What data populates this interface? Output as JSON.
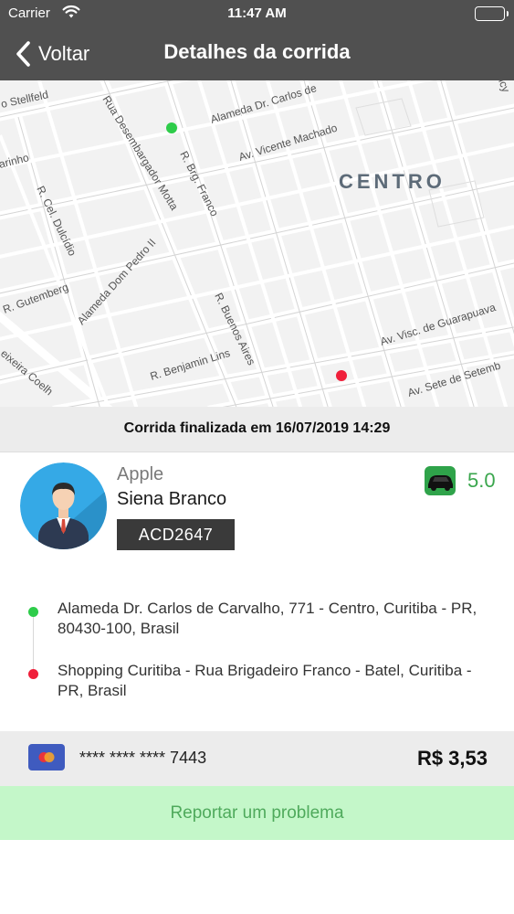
{
  "status_bar": {
    "carrier": "Carrier",
    "time": "11:47 AM"
  },
  "nav": {
    "back_label": "Voltar",
    "title": "Detalhes da corrida"
  },
  "map": {
    "district": "CENTRO",
    "streets": [
      "o Stellfeld",
      "Alameda Dr. Carlos de",
      "Rua Desembargador Motta",
      "Av. Vicente Machado",
      "R. Brg. Franco",
      "arinho",
      "R. Cel. Dulcídio",
      "Alameda Dom Pedro II",
      "R. Gutemberg",
      "R. Buenos Aires",
      "Av. Visc. de Guarapuava",
      "R. Benjamin Lins",
      "Av. Sete de Setemb",
      "eixeira Coelh",
      "icy"
    ],
    "origin_color": "#2ecc4a",
    "destination_color": "#f01f3a"
  },
  "ride": {
    "finished_text": "Corrida finalizada em 16/07/2019 14:29"
  },
  "driver": {
    "company": "Apple",
    "car": "Siena Branco",
    "plate": "ACD2647",
    "rating": "5.0",
    "avatar_icon": "driver-avatar-icon",
    "car_icon": "car-icon"
  },
  "route": {
    "origin": "Alameda Dr. Carlos de Carvalho, 771 - Centro, Curitiba - PR, 80430-100, Brasil",
    "destination": "Shopping Curitiba - Rua Brigadeiro Franco - Batel, Curitiba - PR, Brasil"
  },
  "payment": {
    "card_number": "**** **** **** 7443",
    "price": "R$ 3,53",
    "card_icon": "mastercard-icon"
  },
  "actions": {
    "report_label": "Reportar um problema"
  },
  "colors": {
    "bar": "#505050",
    "accent_green": "#3aa64d",
    "report_bg": "#c4f7c9"
  }
}
